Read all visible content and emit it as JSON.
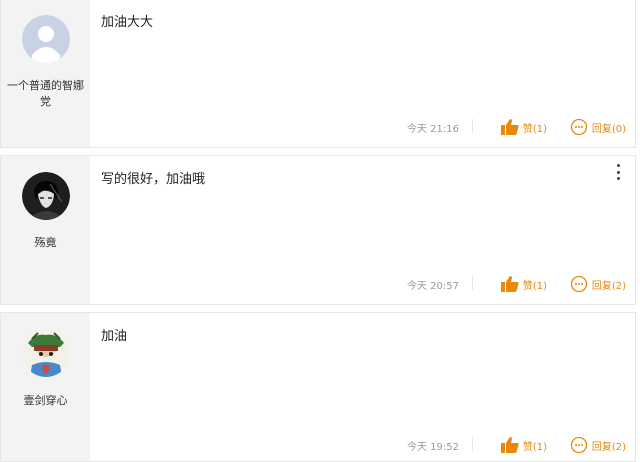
{
  "comments": [
    {
      "username_line1": "一个普通的智娜",
      "username_line2": "党",
      "text": "加油大大",
      "time": "今天 21:16",
      "like_label": "赞(1)",
      "reply_label": "回复(0)"
    },
    {
      "username_line1": "殇竟",
      "username_line2": "",
      "text": "写的很好，加油哦",
      "time": "今天 20:57",
      "like_label": "赞(1)",
      "reply_label": "回复(2)"
    },
    {
      "username_line1": "壹剑穿心",
      "username_line2": "",
      "text": "加油",
      "time": "今天 19:52",
      "like_label": "赞(1)",
      "reply_label": "回复(2)"
    }
  ],
  "colors": {
    "accent": "#e8890c",
    "left_bg": "#f3f3f3",
    "border": "#e6e6e6"
  },
  "icons": [
    "default-avatar-icon",
    "thumbs-up-icon",
    "comment-reply-icon",
    "more-vertical-icon"
  ]
}
